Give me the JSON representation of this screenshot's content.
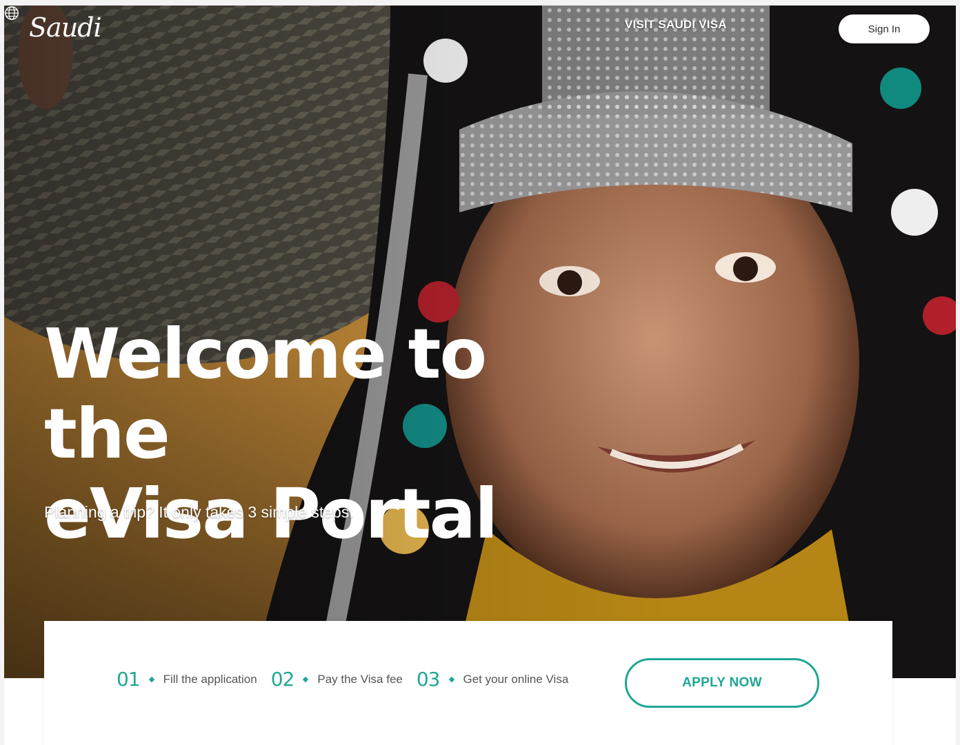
{
  "header": {
    "logo_text": "Saudi",
    "nav_link": "VISIT SAUDI VISA",
    "language_icon": "globe-icon",
    "sign_in_label": "Sign In"
  },
  "hero": {
    "title_line1": "Welcome to the",
    "title_line2": "eVisa Portal",
    "subtitle": "Planning a trip? It only takes 3 simple steps."
  },
  "steps": [
    {
      "number": "01",
      "label": "Fill the application"
    },
    {
      "number": "02",
      "label": "Pay the Visa fee"
    },
    {
      "number": "03",
      "label": "Get your online Visa"
    }
  ],
  "cta": {
    "apply_label": "APPLY NOW"
  },
  "colors": {
    "accent": "#1fa693",
    "hero_text": "#ffffff"
  }
}
